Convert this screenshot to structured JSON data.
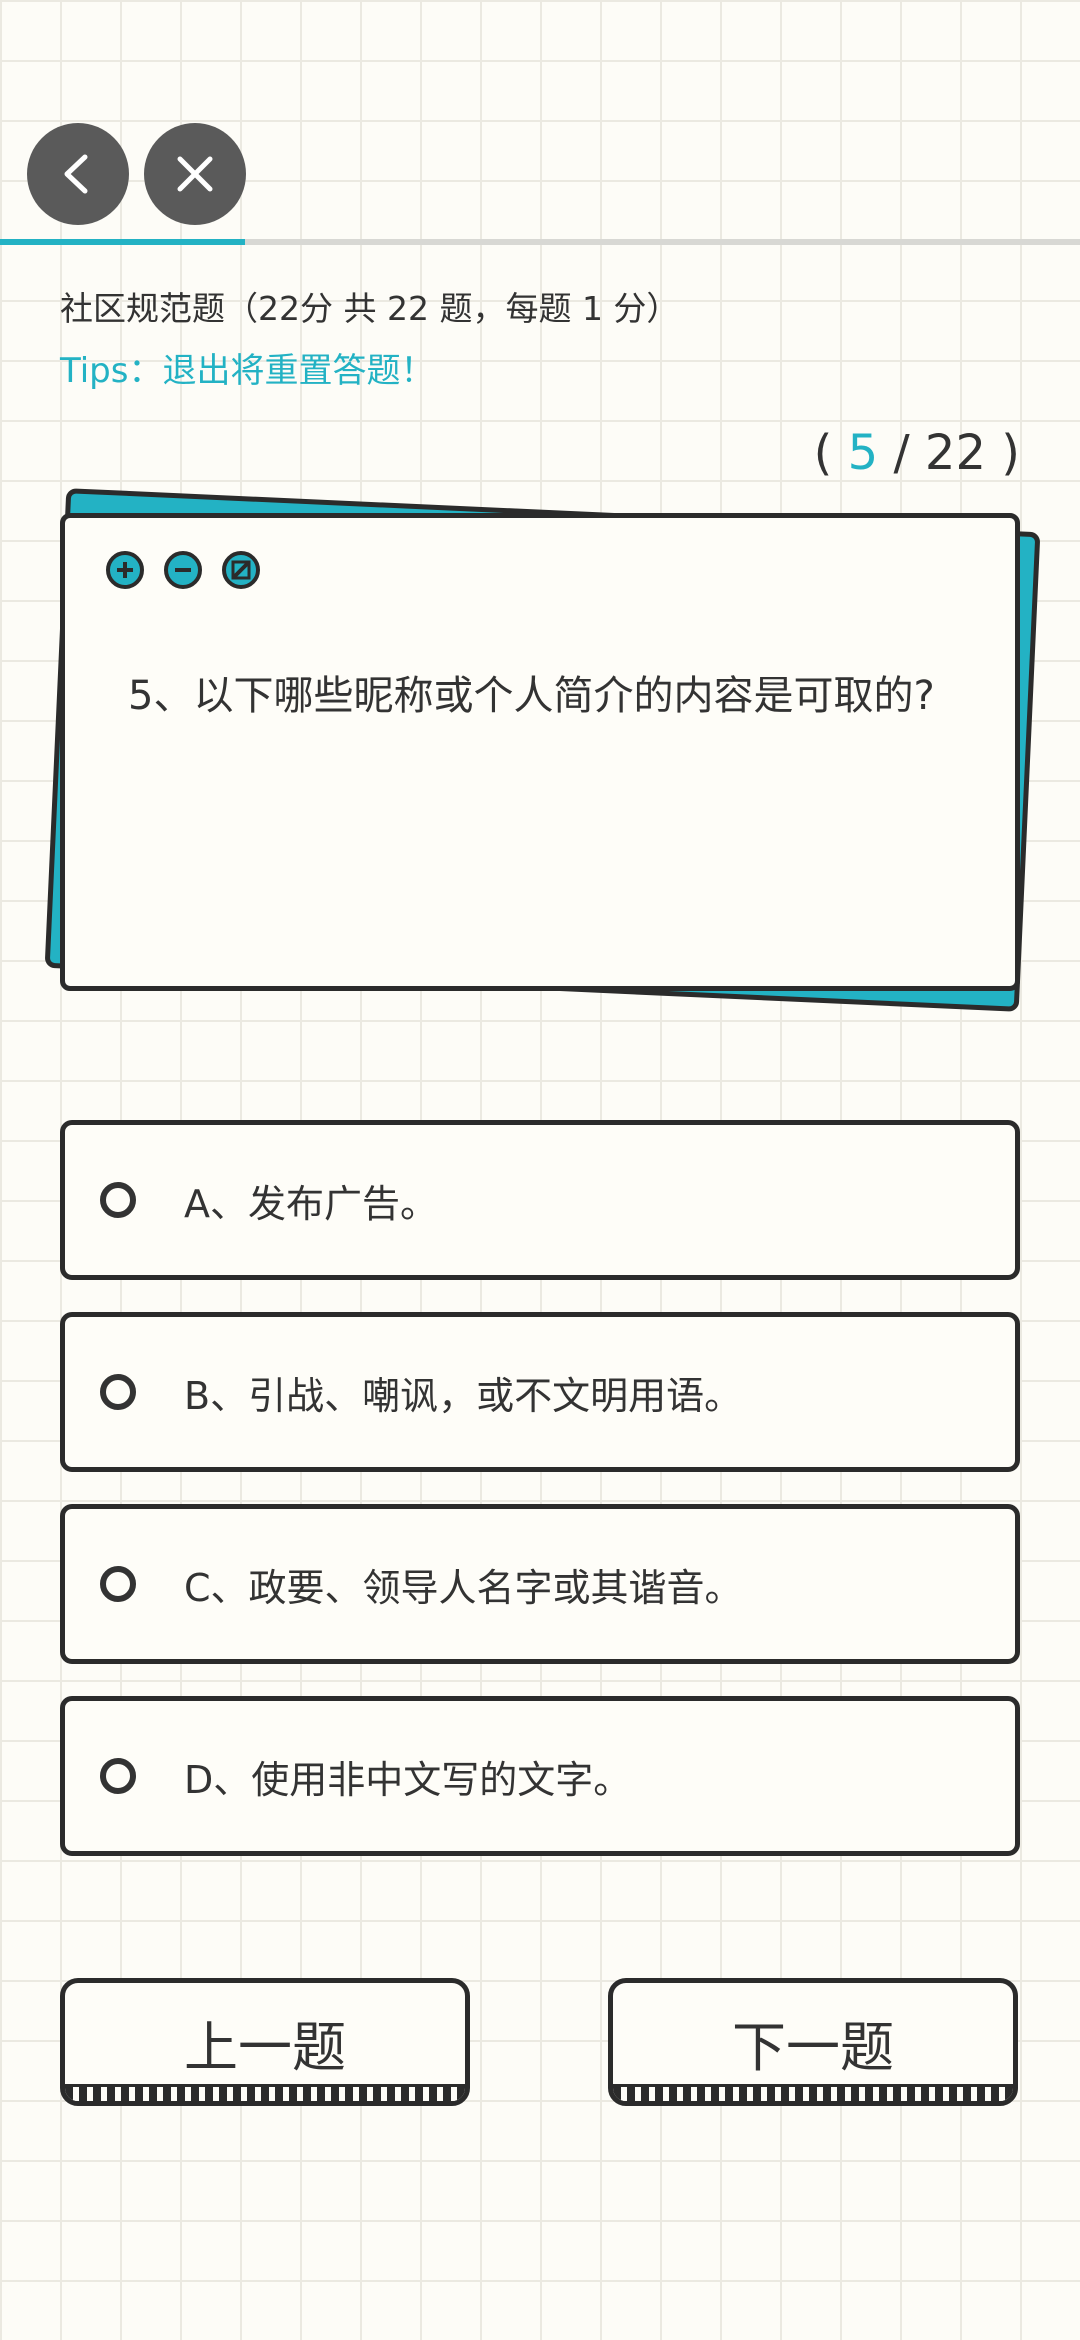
{
  "header": {
    "back_icon": "chevron-left-icon",
    "close_icon": "close-icon"
  },
  "progress": {
    "current": 5,
    "total": 22,
    "fraction": 0.227
  },
  "section": {
    "title": "社区规范题（22分 共 22 题，每题 1 分）",
    "tips": "Tips：退出将重置答题！"
  },
  "counter": {
    "open": "(",
    "current": "5",
    "separator": "/",
    "total": "22",
    "close": ")"
  },
  "card": {
    "icons": [
      "plus-circle-icon",
      "minus-circle-icon",
      "slash-circle-icon"
    ],
    "question": "5、以下哪些昵称或个人简介的内容是可取的?"
  },
  "options": [
    {
      "label": "A、发布广告。"
    },
    {
      "label": "B、引战、嘲讽，或不文明用语。"
    },
    {
      "label": "C、政要、领导人名字或其谐音。"
    },
    {
      "label": "D、使用非中文写的文字。"
    }
  ],
  "nav": {
    "prev_label": "上一题",
    "next_label": "下一题"
  },
  "colors": {
    "accent": "#23b2c4",
    "dark": "#2b2b2b",
    "background": "#fdfcf7"
  }
}
